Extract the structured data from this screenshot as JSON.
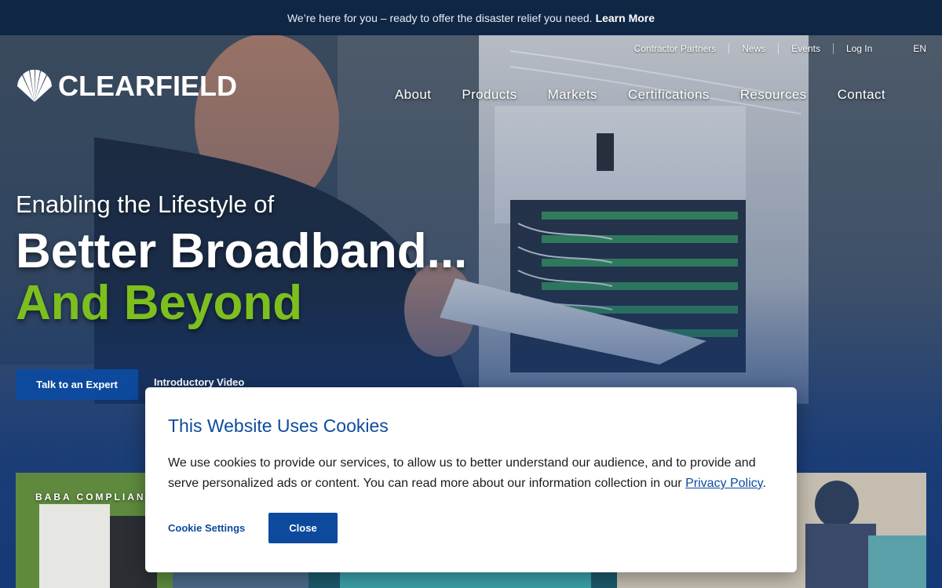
{
  "announcement": {
    "text": "We’re here for you – ready to offer the disaster relief you need.",
    "link": "Learn More"
  },
  "header": {
    "logo_text": "CLEARFIELD",
    "utility_nav": [
      "Contractor Partners",
      "News",
      "Events",
      "Log In"
    ],
    "language": "EN",
    "main_nav": [
      "About",
      "Products",
      "Markets",
      "Certifications",
      "Resources",
      "Contact"
    ]
  },
  "hero": {
    "kicker": "Enabling the Lifestyle of",
    "headline_line1": "Better Broadband...",
    "headline_line2": "And Beyond",
    "cta_label": "Talk to an Expert",
    "video_link": "Introductory Video"
  },
  "cards": [
    {
      "label": "BABA COMPLIANT"
    },
    {
      "label": ""
    },
    {
      "label": ""
    }
  ],
  "cookie_modal": {
    "title": "This Website Uses Cookies",
    "body": "We use cookies to provide our services, to allow us to better understand our audience, and to provide and serve personalized ads or content. You can read more about our information collection in our",
    "policy_link": "Privacy Policy",
    "body_end": ".",
    "settings_label": "Cookie Settings",
    "close_label": "Close"
  },
  "colors": {
    "brand_blue": "#0d4a9e",
    "accent_green": "#7dbf1f",
    "announcement_bg": "#0f2645"
  },
  "icons": [
    "clearfield-shell-logo-icon"
  ]
}
